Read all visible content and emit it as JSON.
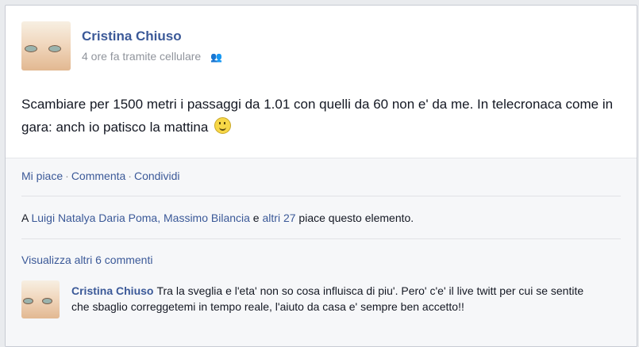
{
  "post": {
    "author": "Cristina Chiuso",
    "time": "4 ore fa tramite cellulare",
    "privacy_icon": "friends-icon",
    "text": "Scambiare per 1500 metri i passaggi da 1.01 con quelli da 60 non e' da me. In telecronaca come in gara: anch io patisco la mattina",
    "emoticon": "smiley-icon"
  },
  "actions": {
    "like": "Mi piace",
    "comment": "Commenta",
    "share": "Condividi"
  },
  "likes": {
    "prefix": "A ",
    "names": "Luigi Natalya Daria Poma, Massimo Bilancia",
    "conj": " e ",
    "others": "altri 27",
    "suffix": " piace questo elemento."
  },
  "comments": {
    "view_more": "Visualizza altri 6 commenti",
    "items": [
      {
        "author": "Cristina Chiuso",
        "text": "Tra la sveglia e l'eta' non so cosa influisca di piu'. Pero' c'e' il live twitt per cui se sentite che sbaglio correggetemi in tempo reale, l'aiuto da casa e' sempre ben accetto!!"
      }
    ]
  },
  "colors": {
    "link": "#3b5998",
    "meta": "#90949c",
    "background": "#e9ebee"
  }
}
